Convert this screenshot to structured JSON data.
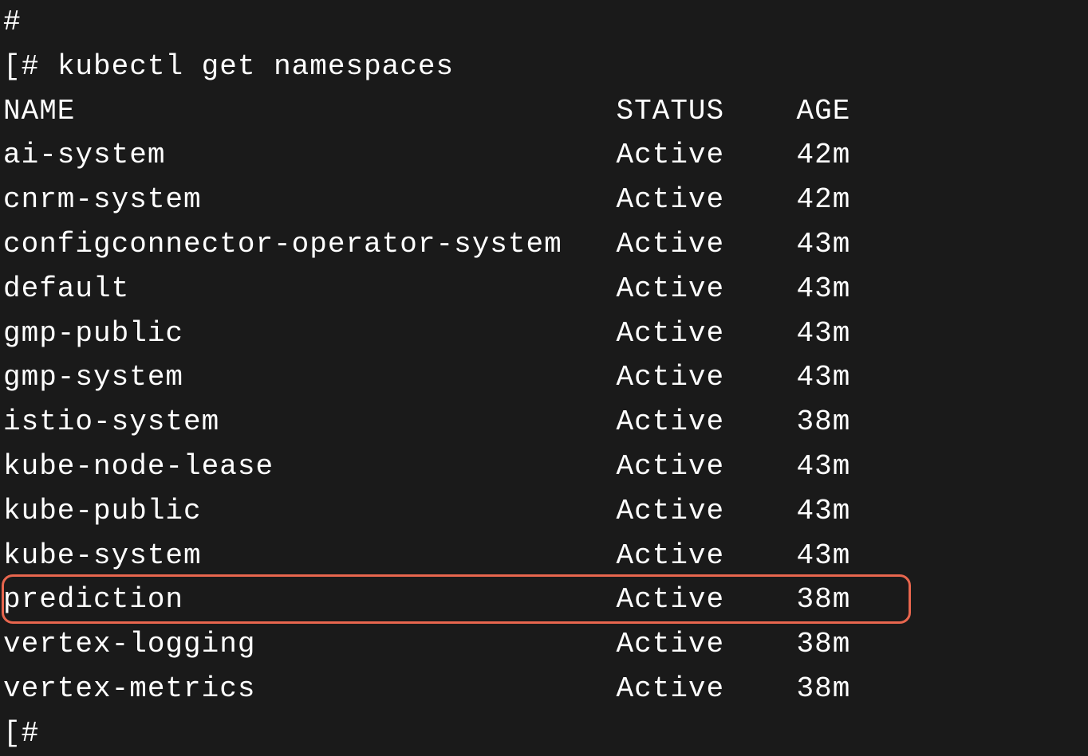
{
  "prompt_hash": "#",
  "prompt_bracket": "[#",
  "command": " kubectl get namespaces",
  "headers": {
    "name": "NAME",
    "status": "STATUS",
    "age": "AGE"
  },
  "rows": [
    {
      "name": "ai-system",
      "status": "Active",
      "age": "42m"
    },
    {
      "name": "cnrm-system",
      "status": "Active",
      "age": "42m"
    },
    {
      "name": "configconnector-operator-system",
      "status": "Active",
      "age": "43m"
    },
    {
      "name": "default",
      "status": "Active",
      "age": "43m"
    },
    {
      "name": "gmp-public",
      "status": "Active",
      "age": "43m"
    },
    {
      "name": "gmp-system",
      "status": "Active",
      "age": "43m"
    },
    {
      "name": "istio-system",
      "status": "Active",
      "age": "38m"
    },
    {
      "name": "kube-node-lease",
      "status": "Active",
      "age": "43m"
    },
    {
      "name": "kube-public",
      "status": "Active",
      "age": "43m"
    },
    {
      "name": "kube-system",
      "status": "Active",
      "age": "43m"
    },
    {
      "name": "prediction",
      "status": "Active",
      "age": "38m"
    },
    {
      "name": "vertex-logging",
      "status": "Active",
      "age": "38m"
    },
    {
      "name": "vertex-metrics",
      "status": "Active",
      "age": "38m"
    }
  ],
  "highlighted_row_index": 10,
  "column_widths": {
    "name": 34,
    "status": 10,
    "age": 3
  }
}
